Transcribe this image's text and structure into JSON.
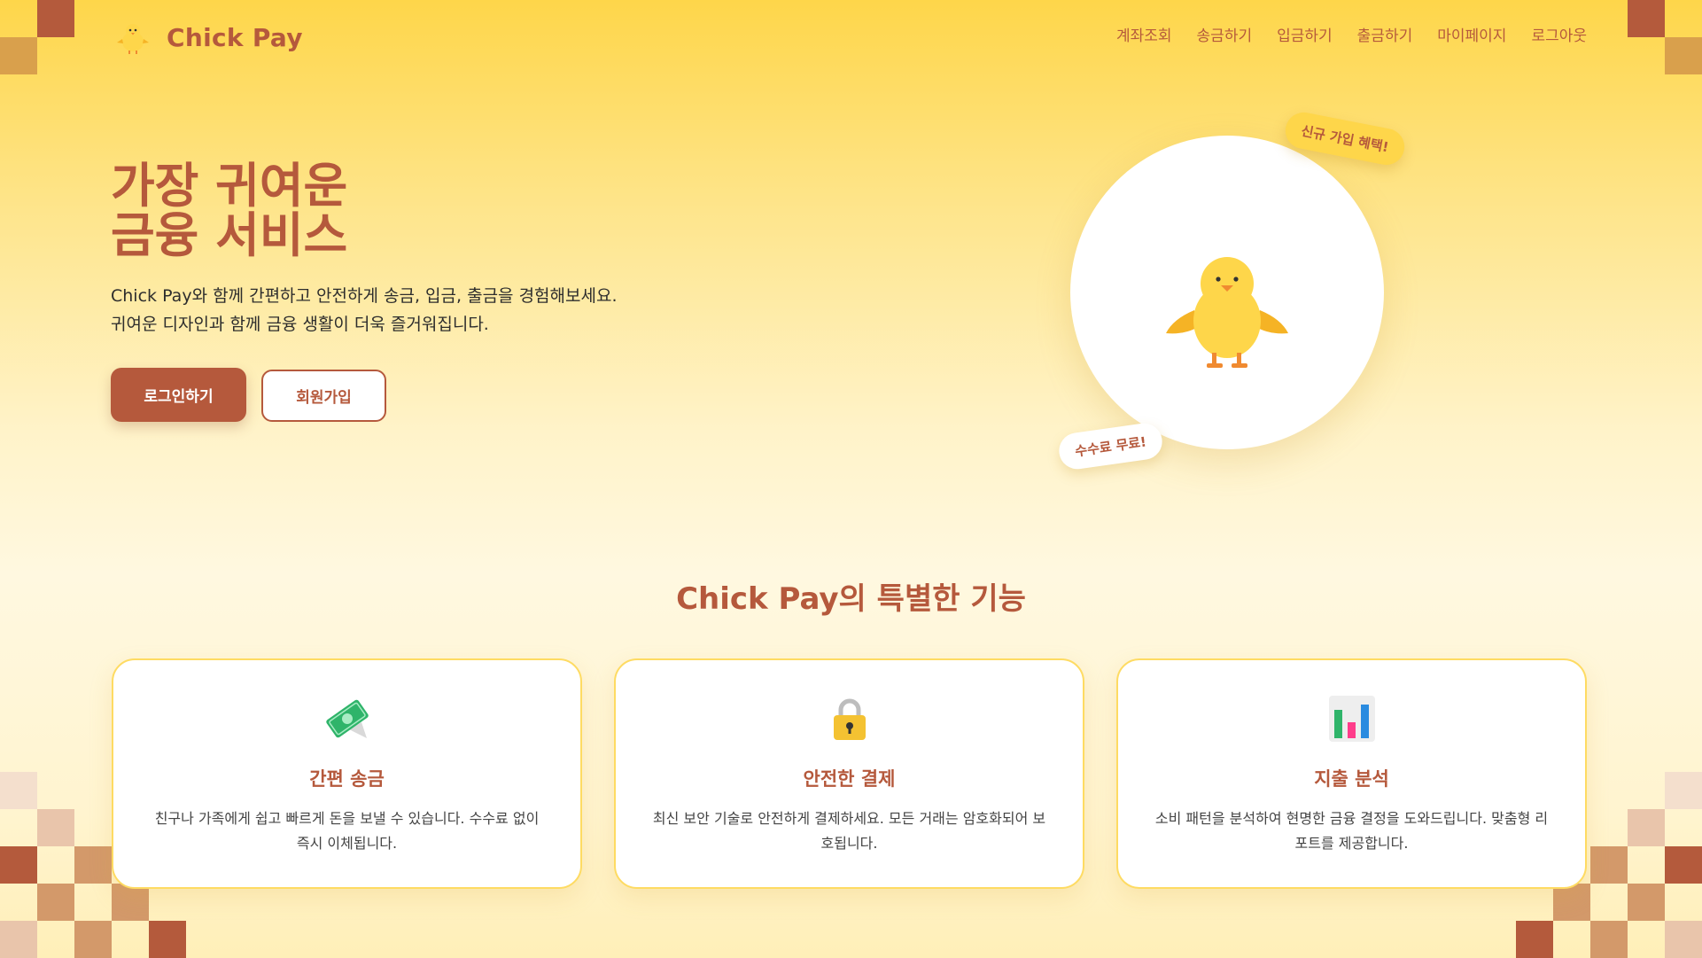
{
  "brand": {
    "name": "Chick Pay",
    "logo_icon": "chick-icon"
  },
  "nav": {
    "items": [
      {
        "label": "계좌조회"
      },
      {
        "label": "송금하기"
      },
      {
        "label": "입금하기"
      },
      {
        "label": "출금하기"
      },
      {
        "label": "마이페이지"
      },
      {
        "label": "로그아웃"
      }
    ]
  },
  "hero": {
    "title_line1": "가장 귀여운",
    "title_line2": "금융 서비스",
    "description": "Chick Pay와 함께 간편하고 안전하게 송금, 입금, 출금을 경험해보세요. 귀여운 디자인과 함께 금융 생활이 더욱 즐거워집니다.",
    "login_label": "로그인하기",
    "signup_label": "회원가입",
    "badge_top": "신규 가입 혜택!",
    "badge_bottom": "수수료 무료!"
  },
  "features": {
    "title": "Chick Pay의 특별한 기능",
    "cards": [
      {
        "icon": "money-wings-icon",
        "title": "간편 송금",
        "description": "친구나 가족에게 쉽고 빠르게 돈을 보낼 수 있습니다. 수수료 없이 즉시 이체됩니다."
      },
      {
        "icon": "lock-icon",
        "title": "안전한 결제",
        "description": "최신 보안 기술로 안전하게 결제하세요. 모든 거래는 암호화되어 보호됩니다."
      },
      {
        "icon": "bar-chart-icon",
        "title": "지출 분석",
        "description": "소비 패턴을 분석하여 현명한 금융 결정을 도와드립니다. 맞춤형 리포트를 제공합니다."
      }
    ]
  },
  "colors": {
    "accent": "#b5593c",
    "primary_yellow": "#fed64a",
    "card_border": "#fedb62"
  }
}
